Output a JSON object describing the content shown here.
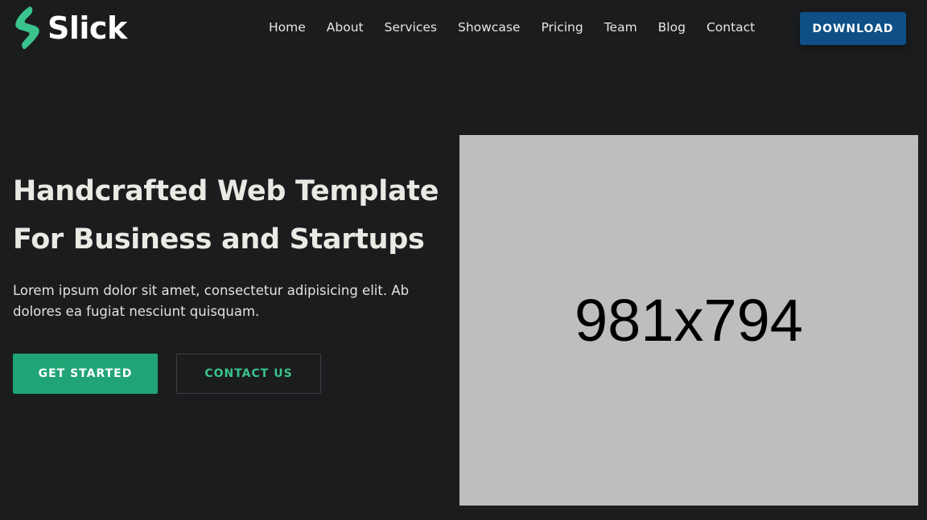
{
  "brand": {
    "name": "Slick",
    "logo_icon": "lightning-bolt-icon",
    "accent_color": "#3ac48d"
  },
  "nav": {
    "items": [
      {
        "label": "Home"
      },
      {
        "label": "About"
      },
      {
        "label": "Services"
      },
      {
        "label": "Showcase"
      },
      {
        "label": "Pricing"
      },
      {
        "label": "Team"
      },
      {
        "label": "Blog"
      },
      {
        "label": "Contact"
      }
    ],
    "download_label": "DOWNLOAD",
    "download_color": "#0d4f86"
  },
  "hero": {
    "title_line1": "Handcrafted Web Template",
    "title_line2": "For Business and Startups",
    "text": "Lorem ipsum dolor sit amet, consectetur adipisicing elit. Ab dolores ea fugiat nesciunt quisquam.",
    "primary_button": "GET STARTED",
    "secondary_button": "CONTACT US",
    "primary_color": "#21a475",
    "image_placeholder_label": "981x794"
  }
}
